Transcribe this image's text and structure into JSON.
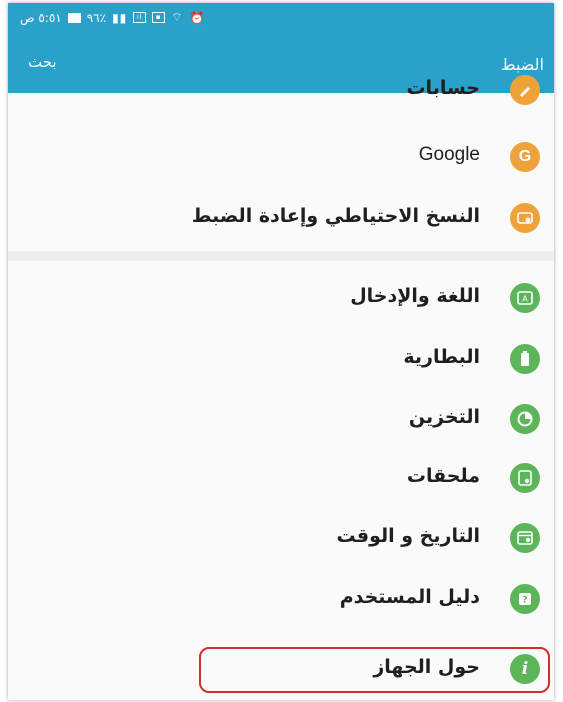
{
  "status_bar": {
    "time": "٥:٥١ ص",
    "battery": "٩٦٪"
  },
  "app_bar": {
    "title": "الضبط",
    "search_label": "بحث"
  },
  "colors": {
    "accent": "#2aa1c9",
    "orange": "#f0a23a",
    "green": "#5db55a",
    "highlight": "#d32e2e"
  },
  "settings": {
    "top_items": [
      {
        "label": "حسابات",
        "icon": "accounts-icon",
        "color": "orange"
      },
      {
        "label": "Google",
        "icon": "google-icon",
        "color": "orange"
      },
      {
        "label": "النسخ الاحتياطي وإعادة الضبط",
        "icon": "backup-reset-icon",
        "color": "orange"
      }
    ],
    "bottom_items": [
      {
        "label": "اللغة والإدخال",
        "icon": "language-input-icon",
        "color": "green"
      },
      {
        "label": "البطارية",
        "icon": "battery-icon",
        "color": "green"
      },
      {
        "label": "التخزين",
        "icon": "storage-icon",
        "color": "green"
      },
      {
        "label": "ملحقات",
        "icon": "accessories-icon",
        "color": "green"
      },
      {
        "label": "التاريخ و الوقت",
        "icon": "date-time-icon",
        "color": "green"
      },
      {
        "label": "دليل المستخدم",
        "icon": "user-manual-icon",
        "color": "green"
      },
      {
        "label": "حول الجهاز",
        "icon": "about-device-icon",
        "color": "green"
      }
    ]
  }
}
